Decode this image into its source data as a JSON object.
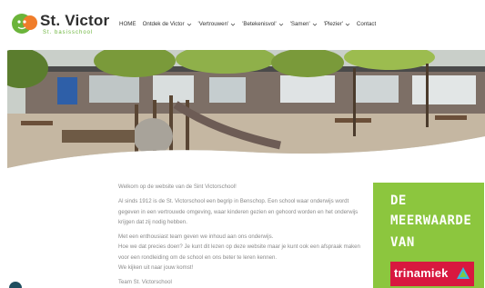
{
  "logo": {
    "title": "St. Victor",
    "subtitle": "St. basisschool"
  },
  "nav": {
    "items": [
      {
        "label": "HOME",
        "has_dropdown": false
      },
      {
        "label": "Ontdek de Victor",
        "has_dropdown": true
      },
      {
        "label": "'Vertrouwen'",
        "has_dropdown": true
      },
      {
        "label": "'Betekenisvol'",
        "has_dropdown": true
      },
      {
        "label": "'Samen'",
        "has_dropdown": true
      },
      {
        "label": "'Plezier'",
        "has_dropdown": true
      },
      {
        "label": "Contact",
        "has_dropdown": false
      }
    ]
  },
  "content": {
    "welcome": "Welkom op de website van de Sint Victorschool!",
    "para1": "Al sinds 1912 is de St. Victorschool een begrip in Benschop. Een school waar onderwijs wordt gegeven in een vertrouwde omgeving, waar kinderen gezien en gehoord worden en het onderwijs krijgen dat zij nodig hebben.",
    "para2_line1": "Met een enthousiast team geven we inhoud aan ons onderwijs.",
    "para2_line2": "Hoe we dat precies doen? Je kunt dit lezen op deze website maar je kunt ook een afspraak maken voor een rondleiding om de school en ons beter te leren kennen.",
    "para2_line3": "We kijken uit naar jouw komst!",
    "signoff": "Team St. Victorschool"
  },
  "promo": {
    "line1": "DE",
    "line2": "MEERWAARDE",
    "line3": "VAN",
    "brand": "trinamiek"
  },
  "colors": {
    "accent_green": "#8cc63e",
    "brand_red": "#d8183f",
    "text_gray": "#8a8a8a"
  }
}
